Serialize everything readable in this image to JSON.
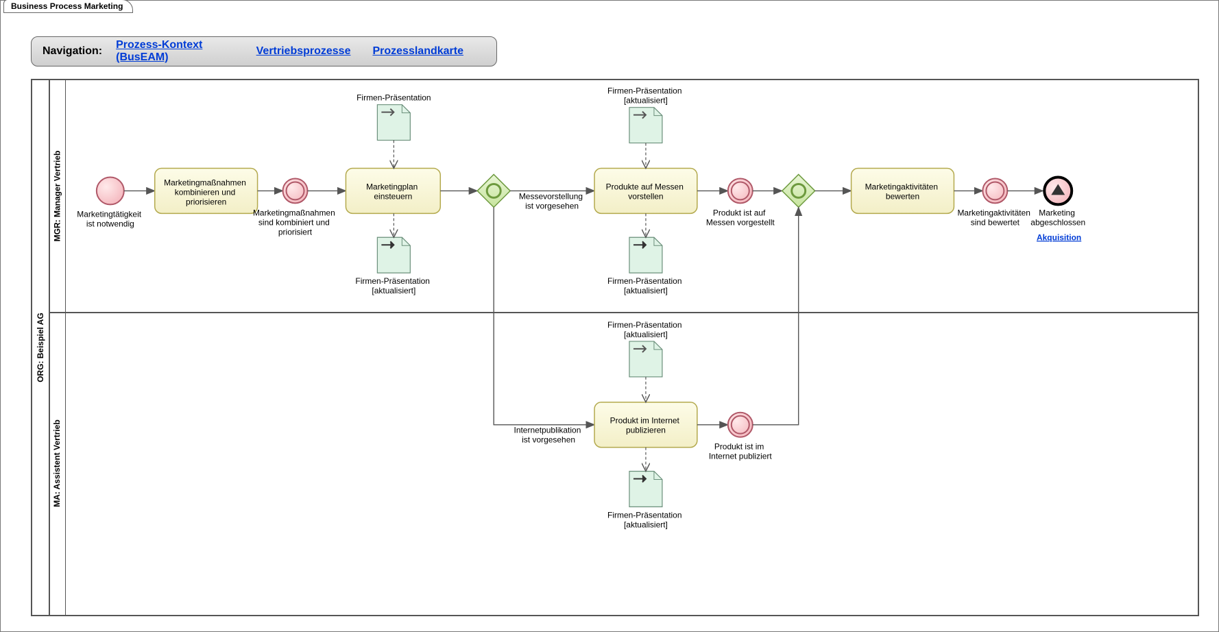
{
  "frame_title": "Business Process Marketing",
  "nav": {
    "title": "Navigation:",
    "links": [
      "Prozess-Kontext (BusEAM)",
      "Vertriebsprozesse",
      "Prozesslandkarte"
    ]
  },
  "pool": "ORG: Beispiel AG",
  "lanes": {
    "top": "MGR: Manager Vertrieb",
    "bottom": "MA: Assistent Vertrieb"
  },
  "events": {
    "start": {
      "label": "Marketingtätigkeit\nist notwendig"
    },
    "im1": {
      "label": "Marketingmaßnahmen\nsind kombiniert und\npriorisiert"
    },
    "im2": {
      "label": "Produkt ist auf\nMessen vorgestellt"
    },
    "im3": {
      "label": "Produkt ist im\nInternet publiziert"
    },
    "im4": {
      "label": "Marketingaktivitäten\nsind bewertet"
    },
    "end": {
      "label": "Marketing\nabgeschlossen"
    }
  },
  "tasks": {
    "t1": "Marketingmaßnahmen\nkombinieren und\npriorisieren",
    "t2": "Marketingplan\neinsteuern",
    "t3": "Produkte auf Messen\nvorstellen",
    "t4": "Marketingaktivitäten\nbewerten",
    "t5": "Produkt im Internet\npublizieren"
  },
  "flows": {
    "f_messe": "Messevorstellung\nist vorgesehen",
    "f_internet": "Internetpublikation\nist vorgesehen"
  },
  "data": {
    "d_in_t2": "Firmen-Präsentation",
    "d_out_t2": "Firmen-Präsentation\n[aktualisiert]",
    "d_in_t3": "Firmen-Präsentation\n[aktualisiert]",
    "d_out_t3": "Firmen-Präsentation\n[aktualisiert]",
    "d_in_t5": "Firmen-Präsentation\n[aktualisiert]",
    "d_out_t5": "Firmen-Präsentation\n[aktualisiert]"
  },
  "link_after_end": "Akquisition"
}
